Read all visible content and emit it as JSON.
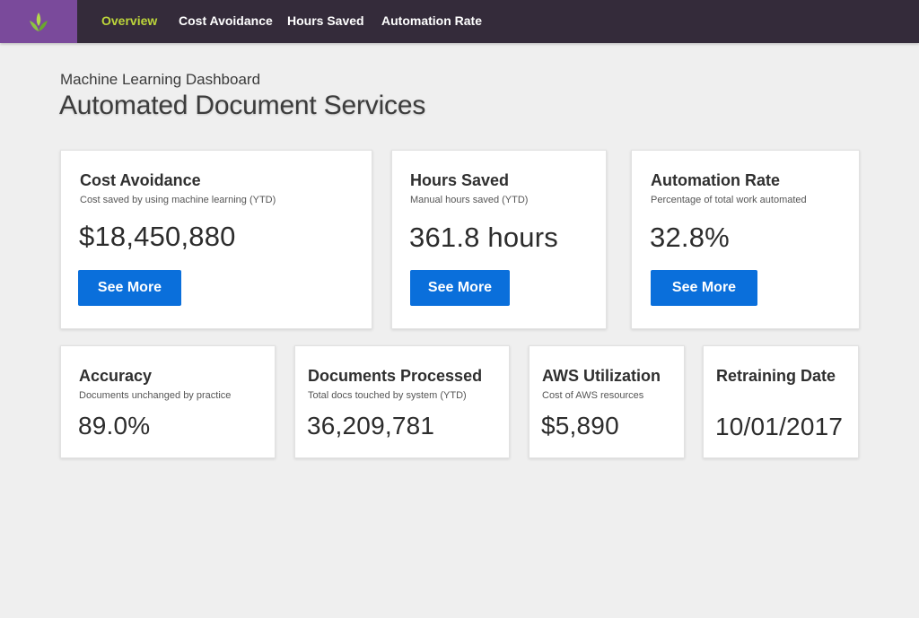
{
  "nav": {
    "items": [
      {
        "label": "Overview",
        "active": true
      },
      {
        "label": "Cost Avoidance",
        "active": false
      },
      {
        "label": "Hours Saved",
        "active": false
      },
      {
        "label": "Automation Rate",
        "active": false
      }
    ],
    "logo_icon": "sprout-icon",
    "active_color": "#bcd53a",
    "bar_color": "#342b3a",
    "logo_bg": "#7a4a9b"
  },
  "header": {
    "subtitle": "Machine Learning Dashboard",
    "title": "Automated Document Services"
  },
  "cards_top": [
    {
      "title": "Cost Avoidance",
      "desc": "Cost saved by using machine learning (YTD)",
      "value": "$18,450,880",
      "button": "See More"
    },
    {
      "title": "Hours Saved",
      "desc": "Manual hours saved (YTD)",
      "value": "361.8 hours",
      "button": "See More"
    },
    {
      "title": "Automation Rate",
      "desc": "Percentage of total work automated",
      "value": "32.8%",
      "button": "See More"
    }
  ],
  "cards_bottom": [
    {
      "title": "Accuracy",
      "desc": "Documents unchanged by practice",
      "value": "89.0%"
    },
    {
      "title": "Documents Processed",
      "desc": "Total docs touched by system (YTD)",
      "value": "36,209,781"
    },
    {
      "title": "AWS Utilization",
      "desc": "Cost of AWS resources",
      "value": "$5,890"
    },
    {
      "title": "Retraining Date",
      "desc": "",
      "value": "10/01/2017"
    }
  ],
  "button_color": "#0a6fdb"
}
